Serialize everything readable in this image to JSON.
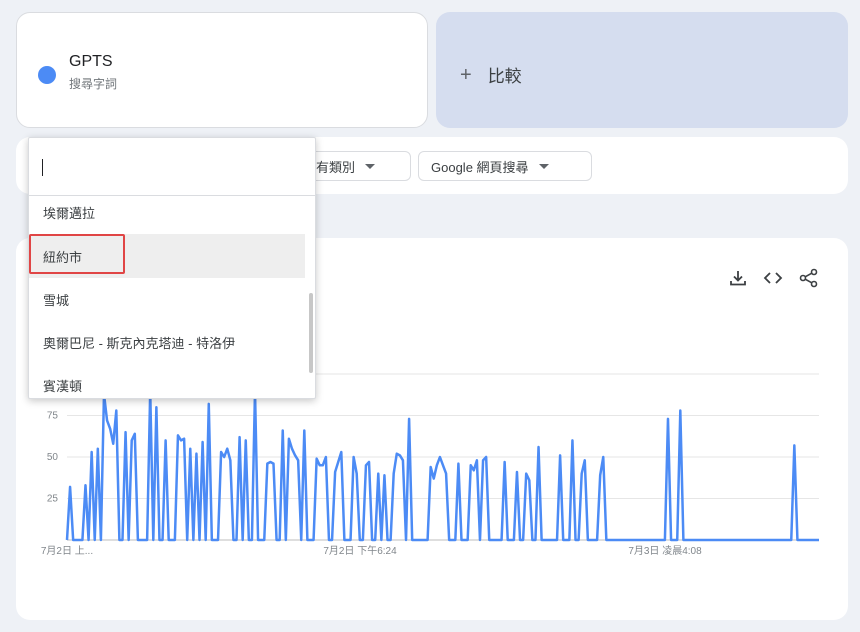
{
  "term": {
    "name": "GPTS",
    "subtitle": "搜尋字詞"
  },
  "compare": {
    "label": "比較"
  },
  "filters": {
    "category": "所有類別",
    "search_type": "Google 網頁搜尋"
  },
  "region_dropdown": {
    "input_value": "",
    "items": [
      "埃爾邁拉",
      "紐約市",
      "雪城",
      "奧爾巴尼 - 斯克內克塔迪 - 特洛伊",
      "賓漢頓"
    ],
    "selected": "紐約市"
  },
  "toolbar": {
    "icons": [
      "download-icon",
      "embed-code-icon",
      "share-icon"
    ]
  },
  "chart_data": {
    "type": "line",
    "y_ticks": [
      25,
      50,
      75
    ],
    "ylim": [
      0,
      100
    ],
    "x_tick_labels": [
      "7月2日 上...",
      "7月2日 下午6:24",
      "7月3日 凌晨4:08"
    ],
    "series": [
      {
        "color": "#4c8bf5",
        "values": [
          0,
          32,
          0,
          0,
          0,
          0,
          33,
          0,
          53,
          0,
          55,
          0,
          88,
          72,
          67,
          58,
          78,
          0,
          0,
          65,
          0,
          60,
          64,
          0,
          0,
          0,
          0,
          90,
          0,
          80,
          0,
          0,
          60,
          0,
          0,
          0,
          63,
          60,
          61,
          0,
          55,
          0,
          52,
          0,
          59,
          0,
          82,
          0,
          0,
          0,
          53,
          50,
          55,
          48,
          0,
          0,
          62,
          0,
          60,
          0,
          0,
          90,
          0,
          0,
          0,
          46,
          47,
          46,
          0,
          0,
          66,
          0,
          61,
          55,
          51,
          48,
          0,
          66,
          0,
          0,
          0,
          49,
          45,
          45,
          50,
          0,
          0,
          41,
          47,
          53,
          0,
          0,
          0,
          50,
          40,
          0,
          0,
          45,
          47,
          0,
          0,
          40,
          0,
          39,
          0,
          0,
          40,
          52,
          51,
          48,
          0,
          73,
          0,
          0,
          0,
          0,
          0,
          0,
          44,
          37,
          45,
          50,
          45,
          40,
          0,
          0,
          0,
          46,
          0,
          0,
          0,
          45,
          42,
          48,
          0,
          48,
          50,
          0,
          0,
          0,
          0,
          0,
          47,
          0,
          0,
          0,
          41,
          0,
          0,
          40,
          36,
          0,
          0,
          56,
          0,
          0,
          0,
          0,
          0,
          0,
          51,
          0,
          0,
          0,
          60,
          0,
          0,
          40,
          48,
          0,
          0,
          0,
          0,
          39,
          50,
          0,
          0,
          0,
          0,
          0,
          0,
          0,
          0,
          0,
          0,
          0,
          0,
          0,
          0,
          0,
          0,
          0,
          0,
          0,
          0,
          73,
          0,
          0,
          0,
          78,
          0,
          0,
          0,
          0,
          0,
          0,
          0,
          0,
          0,
          0,
          0,
          0,
          0,
          0,
          0,
          0,
          0,
          0,
          0,
          0,
          0,
          0,
          0,
          0,
          0,
          0,
          0,
          0,
          0,
          0,
          0,
          0,
          0,
          0,
          0,
          0,
          57,
          0,
          0,
          0,
          0,
          0,
          0,
          0,
          0
        ]
      }
    ]
  }
}
